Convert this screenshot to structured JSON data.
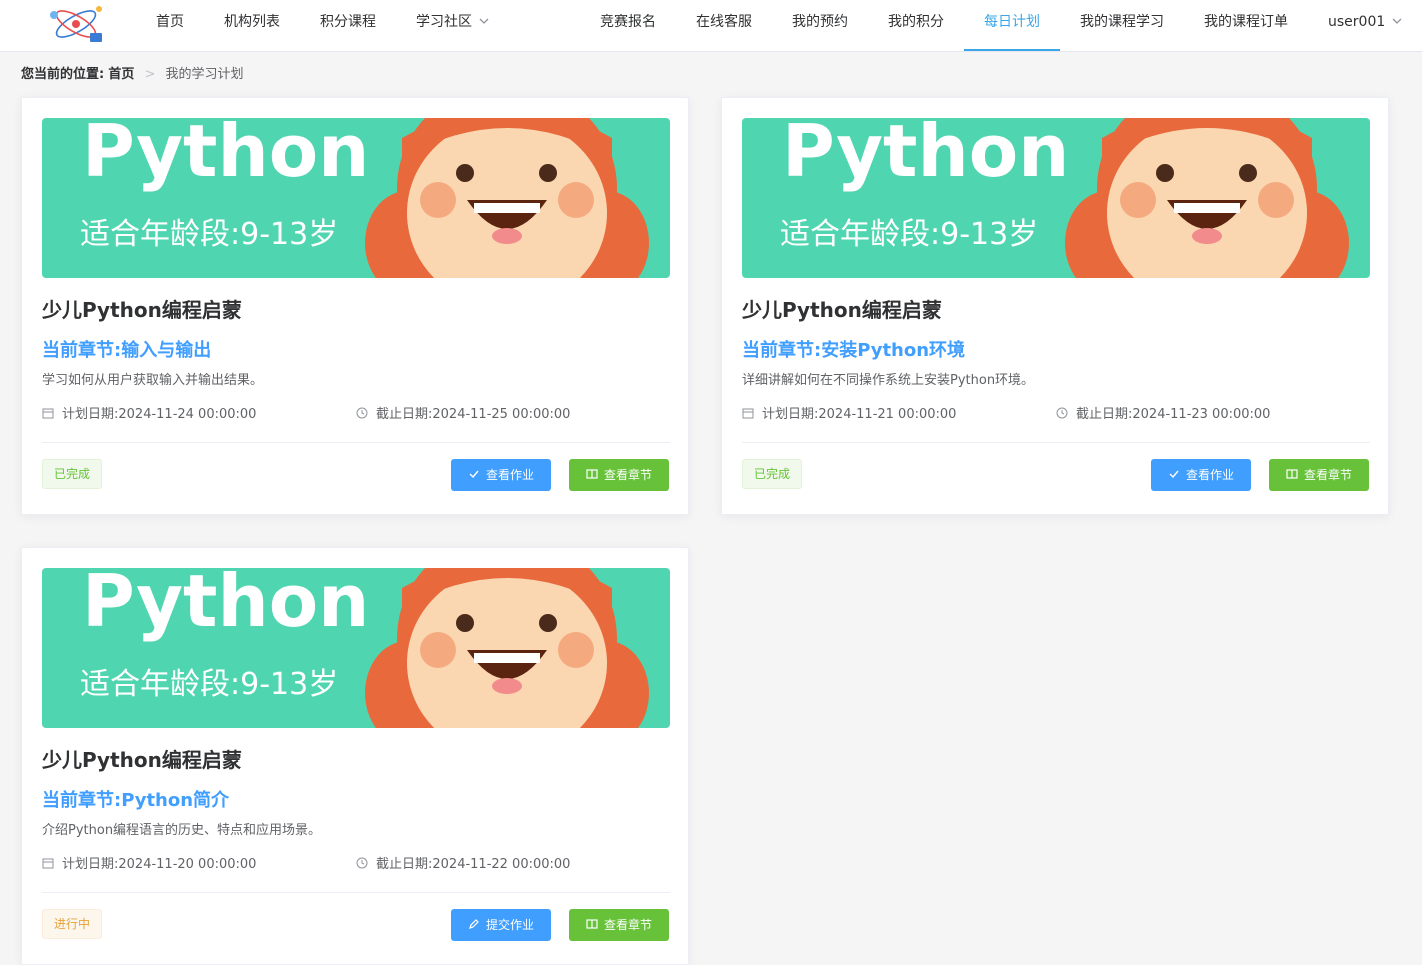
{
  "header": {
    "nav": [
      {
        "label": "首页"
      },
      {
        "label": "机构列表"
      },
      {
        "label": "积分课程"
      },
      {
        "label": "学习社区"
      },
      {
        "label": "竞赛报名"
      },
      {
        "label": "在线客服"
      },
      {
        "label": "我的预约"
      },
      {
        "label": "我的积分"
      },
      {
        "label": "每日计划",
        "active": true
      },
      {
        "label": "我的课程学习"
      },
      {
        "label": "我的课程订单"
      }
    ],
    "user": "user001",
    "accent_color": "#3aa6e8"
  },
  "breadcrumb": {
    "label": "您当前的位置:",
    "home": "首页",
    "current": "我的学习计划"
  },
  "banner": {
    "title": "Python",
    "subtitle": "适合年龄段:9-13岁",
    "bg_color": "#4fd6b0"
  },
  "plans": [
    {
      "course_title": "少儿Python编程启蒙",
      "chapter": "当前章节:输入与输出",
      "description": "学习如何从用户获取输入并输出结果。",
      "plan_date": "计划日期:2024-11-24 00:00:00",
      "due_date": "截止日期:2024-11-25 00:00:00",
      "status": "已完成",
      "status_type": "done",
      "primary_action": "查看作业",
      "primary_icon": "check-icon",
      "secondary_action": "查看章节"
    },
    {
      "course_title": "少儿Python编程启蒙",
      "chapter": "当前章节:安装Python环境",
      "description": "详细讲解如何在不同操作系统上安装Python环境。",
      "plan_date": "计划日期:2024-11-21 00:00:00",
      "due_date": "截止日期:2024-11-23 00:00:00",
      "status": "已完成",
      "status_type": "done",
      "primary_action": "查看作业",
      "primary_icon": "check-icon",
      "secondary_action": "查看章节"
    },
    {
      "course_title": "少儿Python编程启蒙",
      "chapter": "当前章节:Python简介",
      "description": "介绍Python编程语言的历史、特点和应用场景。",
      "plan_date": "计划日期:2024-11-20 00:00:00",
      "due_date": "截止日期:2024-11-22 00:00:00",
      "status": "进行中",
      "status_type": "doing",
      "primary_action": "提交作业",
      "primary_icon": "edit-icon",
      "secondary_action": "查看章节"
    }
  ]
}
